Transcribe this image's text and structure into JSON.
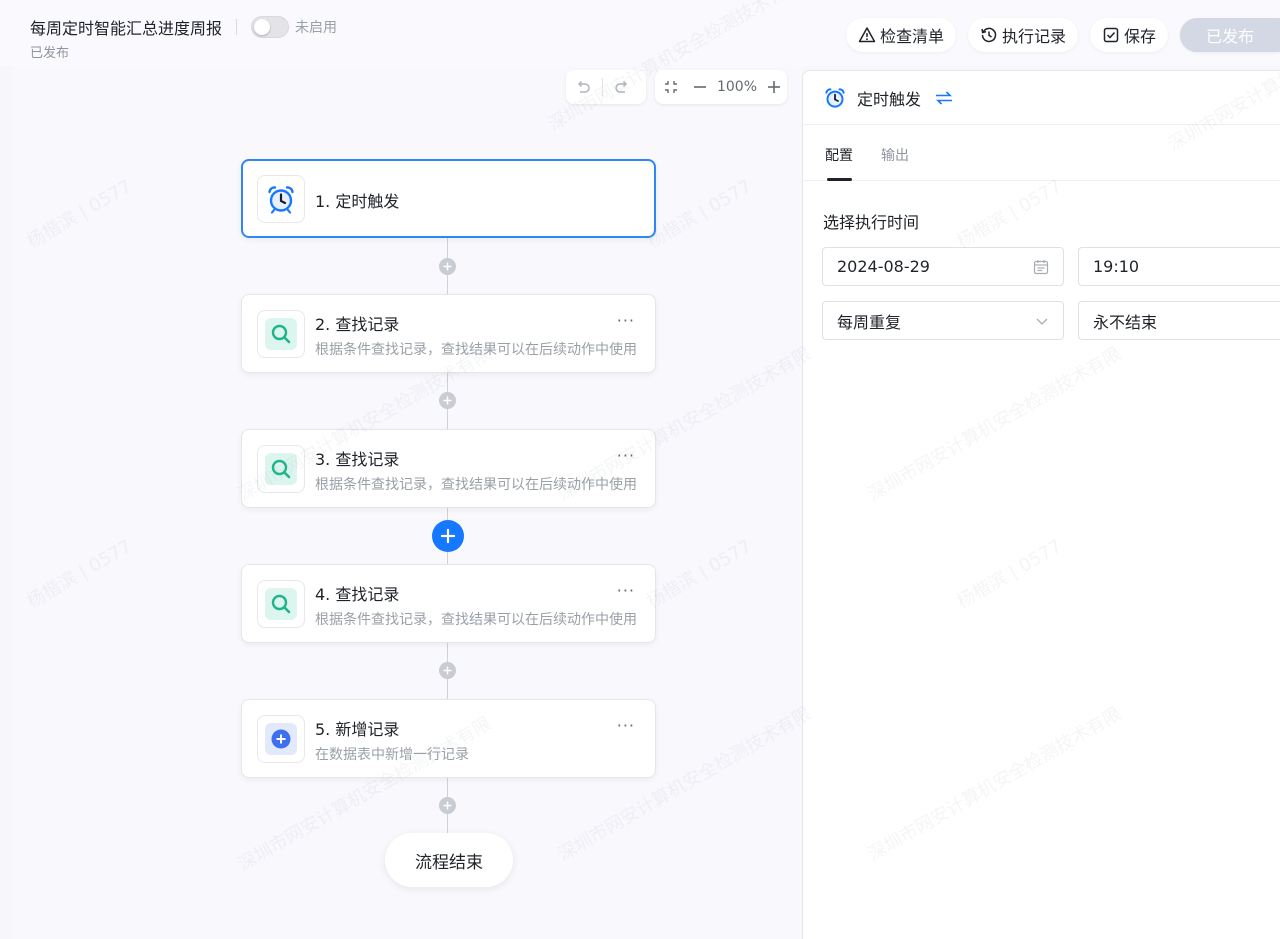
{
  "header": {
    "title": "每周定时智能汇总进度周报",
    "toggle_label": "未启用",
    "status": "已发布",
    "actions": {
      "checklist": "检查清单",
      "history": "执行记录",
      "save": "保存",
      "publish": "已发布"
    }
  },
  "canvas": {
    "zoom": "100%",
    "nodes": [
      {
        "title": "1. 定时触发",
        "desc": ""
      },
      {
        "title": "2. 查找记录",
        "desc": "根据条件查找记录，查找结果可以在后续动作中使用"
      },
      {
        "title": "3. 查找记录",
        "desc": "根据条件查找记录，查找结果可以在后续动作中使用"
      },
      {
        "title": "4. 查找记录",
        "desc": "根据条件查找记录，查找结果可以在后续动作中使用"
      },
      {
        "title": "5. 新增记录",
        "desc": "在数据表中新增一行记录"
      }
    ],
    "more": "···",
    "end_label": "流程结束"
  },
  "panel": {
    "title": "定时触发",
    "tabs": [
      "配置",
      "输出"
    ],
    "section_label": "选择执行时间",
    "date_value": "2024-08-29",
    "time_value": "19:10",
    "repeat_value": "每周重复",
    "end_value": "永不结束"
  },
  "watermark": {
    "line1": "深圳市网安计算机安全检测技术有限",
    "line2": "杨楷滨 | 0577"
  },
  "colors": {
    "accent": "#1677ff",
    "selected_border": "#2f86f6",
    "search_icon": "#1fb58a",
    "add_icon": "#3d6ff0"
  }
}
